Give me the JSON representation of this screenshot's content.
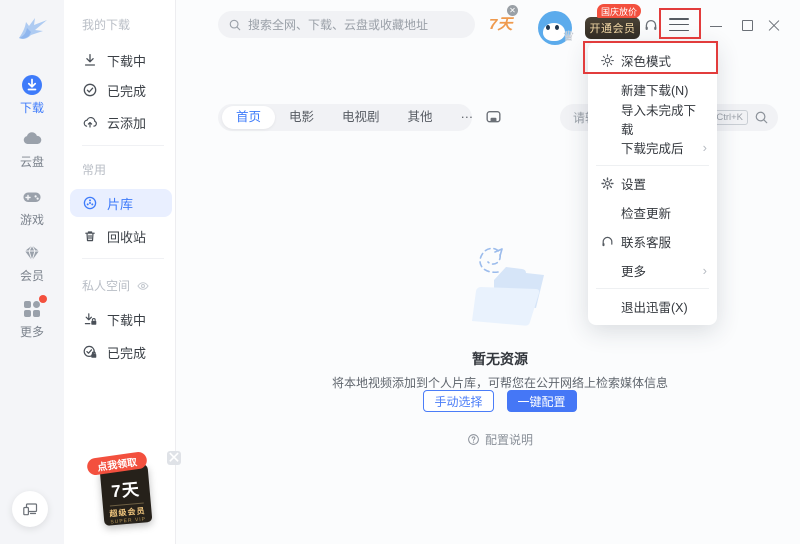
{
  "colors": {
    "accent": "#3e7bfa",
    "annotation_red": "#e23c3c",
    "promo_red": "#f3503e",
    "vip_gold": "#f3d9a6",
    "trial_orange": "#ef9a4e"
  },
  "rail": {
    "items": [
      {
        "label": "下载",
        "icon": "download-circle",
        "active": true
      },
      {
        "label": "云盘",
        "icon": "cloud"
      },
      {
        "label": "游戏",
        "icon": "gamepad"
      },
      {
        "label": "会员",
        "icon": "gem"
      },
      {
        "label": "更多",
        "icon": "grid",
        "has_red_dot": true
      }
    ]
  },
  "sidebar": {
    "sections": [
      {
        "title": "我的下载",
        "items": [
          {
            "label": "下载中",
            "icon": "download"
          },
          {
            "label": "已完成",
            "icon": "check-circle"
          },
          {
            "label": "云添加",
            "icon": "cloud-upload"
          }
        ]
      },
      {
        "title": "常用",
        "items": [
          {
            "label": "片库",
            "icon": "film-reel",
            "active": true
          },
          {
            "label": "回收站",
            "icon": "trash"
          }
        ]
      },
      {
        "title": "私人空间",
        "title_icon": "eye",
        "items": [
          {
            "label": "下载中",
            "icon": "download-lock"
          },
          {
            "label": "已完成",
            "icon": "check-lock"
          }
        ]
      }
    ],
    "ad": {
      "ribbon": "点我领取",
      "headline": "7天",
      "line1": "超级会员",
      "line2": "SUPER VIP"
    }
  },
  "topbar": {
    "search_placeholder": "搜索全网、下载、云盘或收藏地址",
    "trial_label": "7天",
    "vip_button_label": "开通会员",
    "vip_promo_badge": "国庆放价"
  },
  "tabs": {
    "items": [
      {
        "label": "首页",
        "active": true
      },
      {
        "label": "电影"
      },
      {
        "label": "电视剧"
      },
      {
        "label": "其他"
      },
      {
        "label": "···"
      }
    ]
  },
  "library_search": {
    "visible_placeholder": "请输",
    "shortcut": "Ctrl+K"
  },
  "empty_state": {
    "title": "暂无资源",
    "description": "将本地视频添加到个人片库，可帮您在公开网络上检索媒体信息",
    "secondary_button": "手动选择",
    "primary_button": "一键配置",
    "help_text": "配置说明"
  },
  "menu": {
    "items": [
      {
        "label": "深色模式",
        "icon": "sun",
        "highlighted": true
      },
      {
        "label": "新建下载(N)"
      },
      {
        "label": "导入未完成下载"
      },
      {
        "label": "下载完成后",
        "has_submenu": true
      },
      {
        "label": "设置",
        "icon": "gear"
      },
      {
        "label": "检查更新"
      },
      {
        "label": "联系客服",
        "icon": "headset"
      },
      {
        "label": "更多",
        "has_submenu": true
      },
      {
        "label": "退出迅雷(X)"
      }
    ]
  }
}
